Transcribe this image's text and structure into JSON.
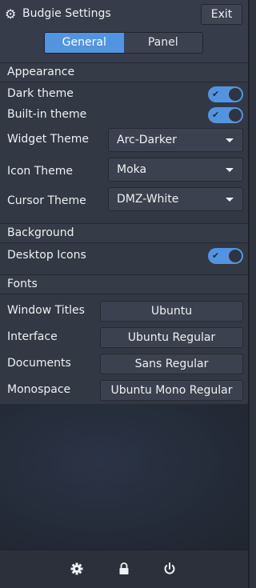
{
  "header": {
    "title": "Budgie Settings",
    "exit_label": "Exit",
    "tabs": [
      {
        "label": "General",
        "active": true
      },
      {
        "label": "Panel",
        "active": false
      }
    ]
  },
  "appearance": {
    "heading": "Appearance",
    "dark_theme": {
      "label": "Dark theme",
      "on": true
    },
    "builtin_theme": {
      "label": "Built-in theme",
      "on": true
    },
    "widget_theme": {
      "label": "Widget Theme",
      "value": "Arc-Darker"
    },
    "icon_theme": {
      "label": "Icon Theme",
      "value": "Moka"
    },
    "cursor_theme": {
      "label": "Cursor Theme",
      "value": "DMZ-White"
    }
  },
  "background": {
    "heading": "Background",
    "desktop_icons": {
      "label": "Desktop Icons",
      "on": true
    }
  },
  "fonts": {
    "heading": "Fonts",
    "window_titles": {
      "label": "Window Titles",
      "value": "Ubuntu"
    },
    "interface": {
      "label": "Interface",
      "value": "Ubuntu Regular"
    },
    "documents": {
      "label": "Documents",
      "value": "Sans Regular"
    },
    "monospace": {
      "label": "Monospace",
      "value": "Ubuntu Mono Regular"
    }
  },
  "footer": {
    "icons": [
      "settings-icon",
      "lock-icon",
      "power-icon"
    ]
  },
  "colors": {
    "accent": "#5294e2",
    "background": "#323844"
  }
}
